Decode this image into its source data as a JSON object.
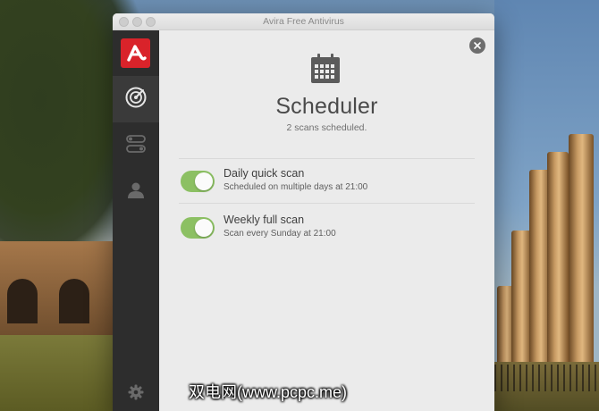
{
  "window": {
    "title": "Avira Free Antivirus"
  },
  "sidebar": {
    "items": [
      {
        "name": "logo",
        "icon": "avira-logo-icon"
      },
      {
        "name": "scan",
        "icon": "radar-icon",
        "active": true
      },
      {
        "name": "modules",
        "icon": "toggles-icon"
      },
      {
        "name": "account",
        "icon": "user-icon"
      }
    ],
    "settings_icon": "gear-icon"
  },
  "scheduler": {
    "icon": "calendar-icon",
    "title": "Scheduler",
    "subtitle": "2 scans scheduled.",
    "scans": [
      {
        "title": "Daily quick scan",
        "description": "Scheduled on multiple days at 21:00",
        "enabled": true
      },
      {
        "title": "Weekly full scan",
        "description": "Scan every Sunday at 21:00",
        "enabled": true
      }
    ]
  },
  "colors": {
    "sidebar": "#2d2d2d",
    "logo_red": "#d9232a",
    "toggle_on": "#8cc063",
    "content_bg": "#ebebeb"
  },
  "watermark": "双电网(www.pcpc.me)"
}
